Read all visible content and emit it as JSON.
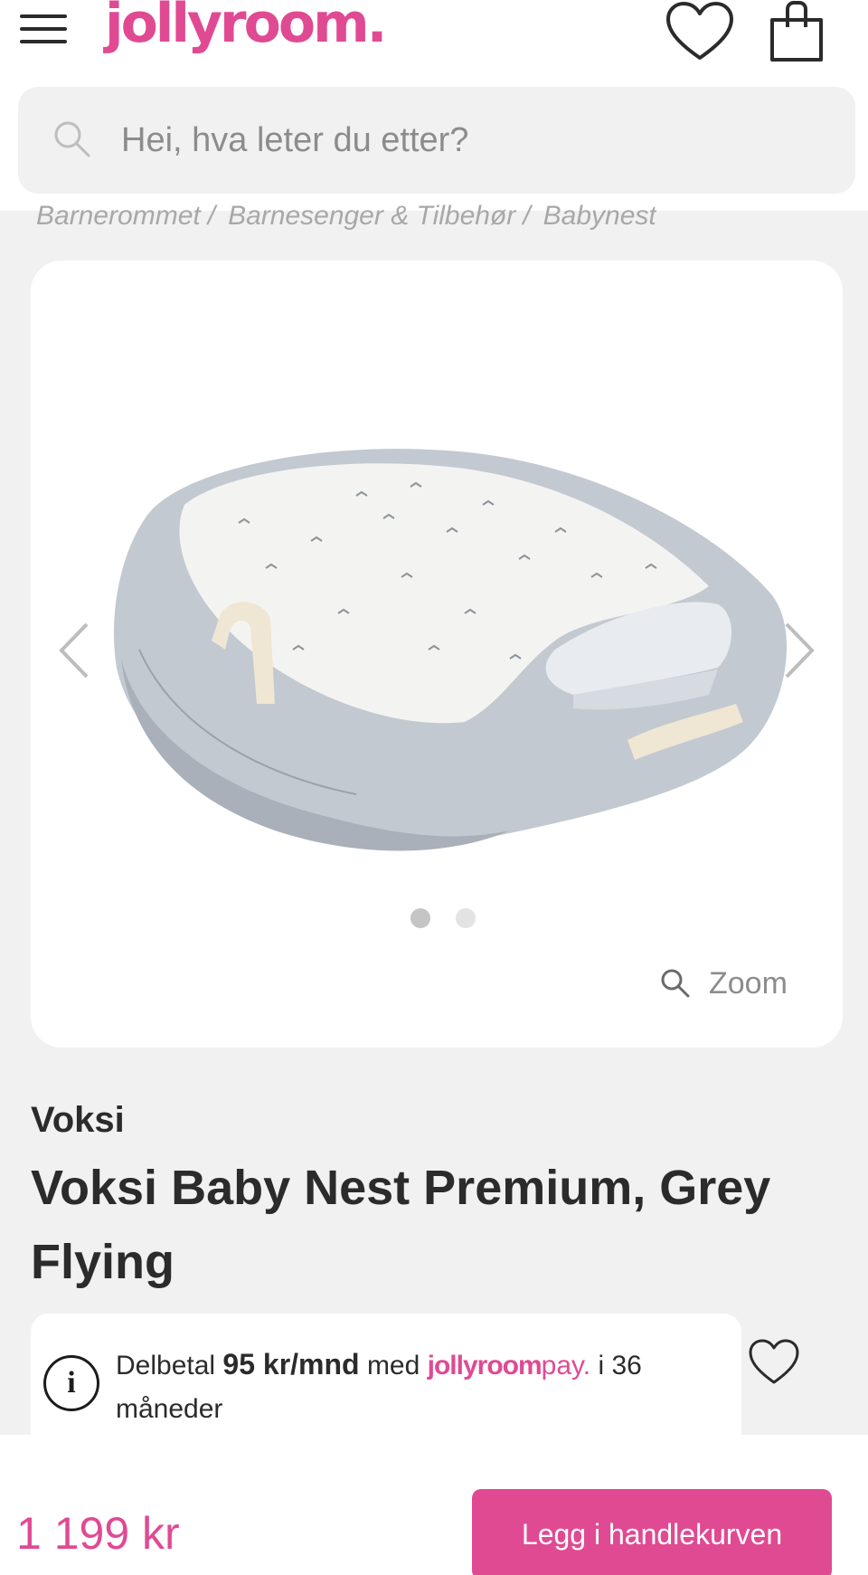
{
  "header": {
    "logo_text": "jollyroom.",
    "icons": {
      "menu": "hamburger-menu-icon",
      "wishlist": "heart-icon",
      "cart": "shopping-bag-icon"
    }
  },
  "search": {
    "placeholder": "Hei, hva leter du etter?",
    "icon": "search-icon"
  },
  "breadcrumb": [
    "Barnerommet",
    "Barnesenger & Tilbehør",
    "Babynest"
  ],
  "breadcrumb_separator": "/",
  "gallery": {
    "image_count": 2,
    "active_index": 0,
    "zoom_label": "Zoom",
    "icons": {
      "prev": "chevron-left-icon",
      "next": "chevron-right-icon",
      "zoom": "magnifier-icon"
    }
  },
  "product": {
    "brand": "Voksi",
    "title": "Voksi Baby Nest Premium, Grey Flying"
  },
  "payment_info": {
    "prefix": "Delbetal",
    "amount": "95 kr/mnd",
    "middle": "med",
    "provider_main": "jollyroom",
    "provider_suffix": "pay.",
    "suffix": "i 36 måneder",
    "icon": "info-icon"
  },
  "bottom_bar": {
    "price": "1 199 kr",
    "cta_label": "Legg i handlekurven"
  },
  "colors": {
    "brand_pink": "#e04a93",
    "page_background": "#f1f1f1",
    "text_dark": "#2b2b2b",
    "text_muted": "#8c8c8c"
  }
}
